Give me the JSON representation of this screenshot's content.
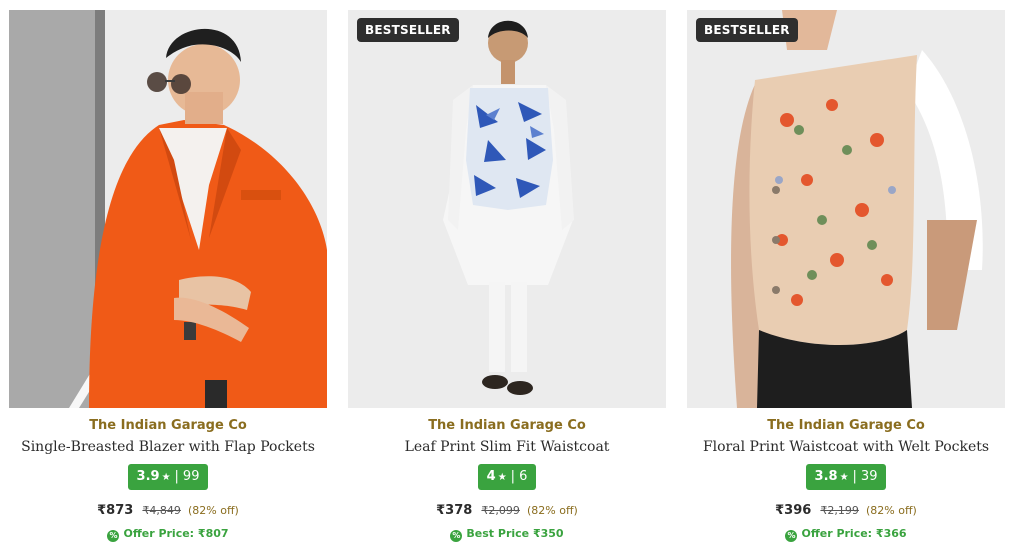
{
  "products": [
    {
      "brand": "The Indian Garage Co",
      "title": "Single-Breasted Blazer with Flap Pockets",
      "rating": "3.9",
      "reviews": "99",
      "price": "₹873",
      "mrp": "₹4,849",
      "discount": "(82% off)",
      "offer": "Offer Price: ₹807",
      "image_alt": "Man in orange single-breasted blazer"
    },
    {
      "badge": "BESTSELLER",
      "brand": "The Indian Garage Co",
      "title": "Leaf Print Slim Fit Waistcoat",
      "rating": "4",
      "reviews": "6",
      "price": "₹378",
      "mrp": "₹2,099",
      "discount": "(82% off)",
      "offer": "Best Price ₹350",
      "image_alt": "Man in blue leaf print waistcoat over white kurta"
    },
    {
      "badge": "BESTSELLER",
      "brand": "The Indian Garage Co",
      "title": "Floral Print Waistcoat with Welt Pockets",
      "rating": "3.8",
      "reviews": "39",
      "price": "₹396",
      "mrp": "₹2,199",
      "discount": "(82% off)",
      "offer": "Offer Price: ₹366",
      "image_alt": "Man in floral print waistcoat"
    }
  ],
  "colors": {
    "brand_text": "#8a6d1f",
    "rating_bg": "#3aa33f",
    "badge_bg": "#2e2e2e",
    "offer_text": "#3aa33f"
  },
  "icons": {
    "rating_star": "star-icon",
    "offer": "offer-tag-icon"
  }
}
